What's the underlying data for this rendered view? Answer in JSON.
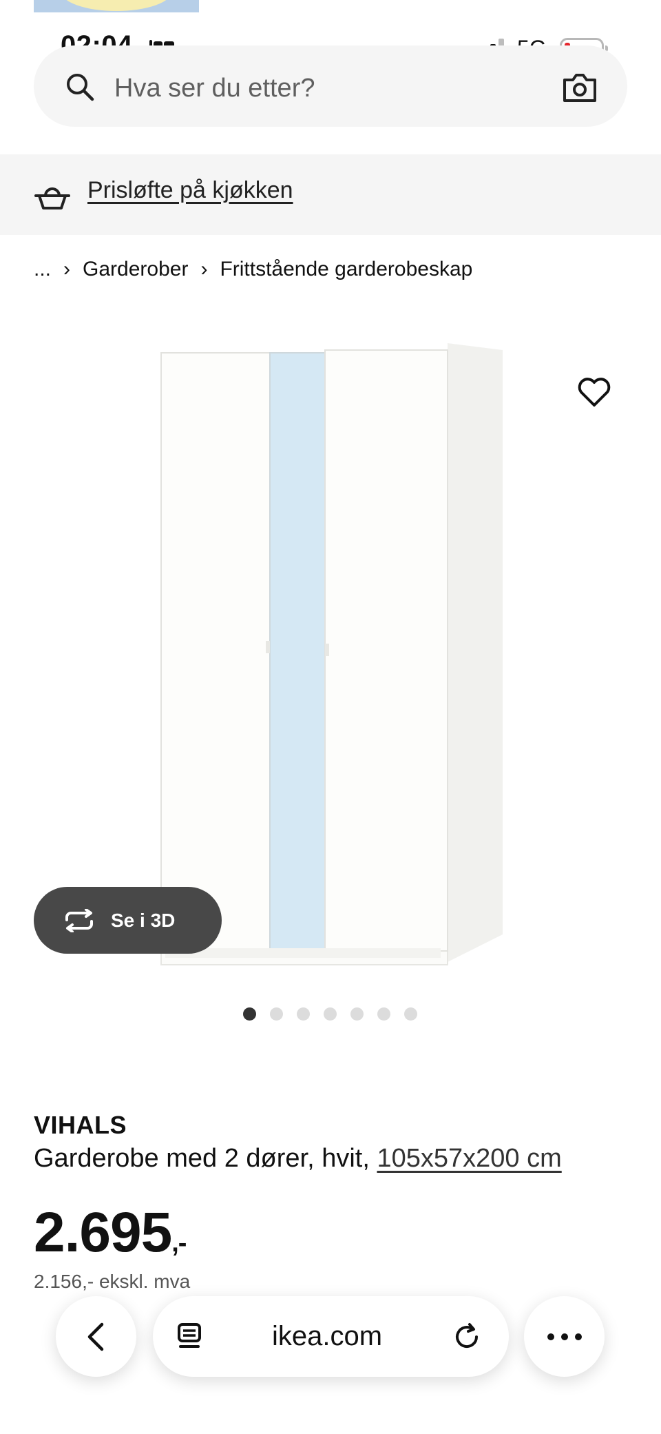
{
  "status": {
    "time": "02:04",
    "network": "5G"
  },
  "search": {
    "placeholder": "Hva ser du etter?"
  },
  "promo": {
    "link": "Prisløfte på kjøkken"
  },
  "breadcrumb": {
    "items": [
      "...",
      "Garderober",
      "Frittstående garderobeskap"
    ],
    "separator": "›"
  },
  "gallery": {
    "button_3d": "Se i 3D",
    "image_count": 7,
    "active_index": 0
  },
  "product": {
    "name": "VIHALS",
    "description": "Garderobe med 2 dører, hvit, ",
    "dimensions": "105x57x200 cm",
    "price": "2.695",
    "price_suffix": ",-",
    "price_ex_vat": "2.156,- ekskl. mva"
  },
  "browser": {
    "url": "ikea.com"
  },
  "colors": {
    "button_dark": "#484848",
    "search_bg": "#f5f5f5",
    "battery_low": "#e5262c",
    "mirror": "#d5e8f4"
  }
}
